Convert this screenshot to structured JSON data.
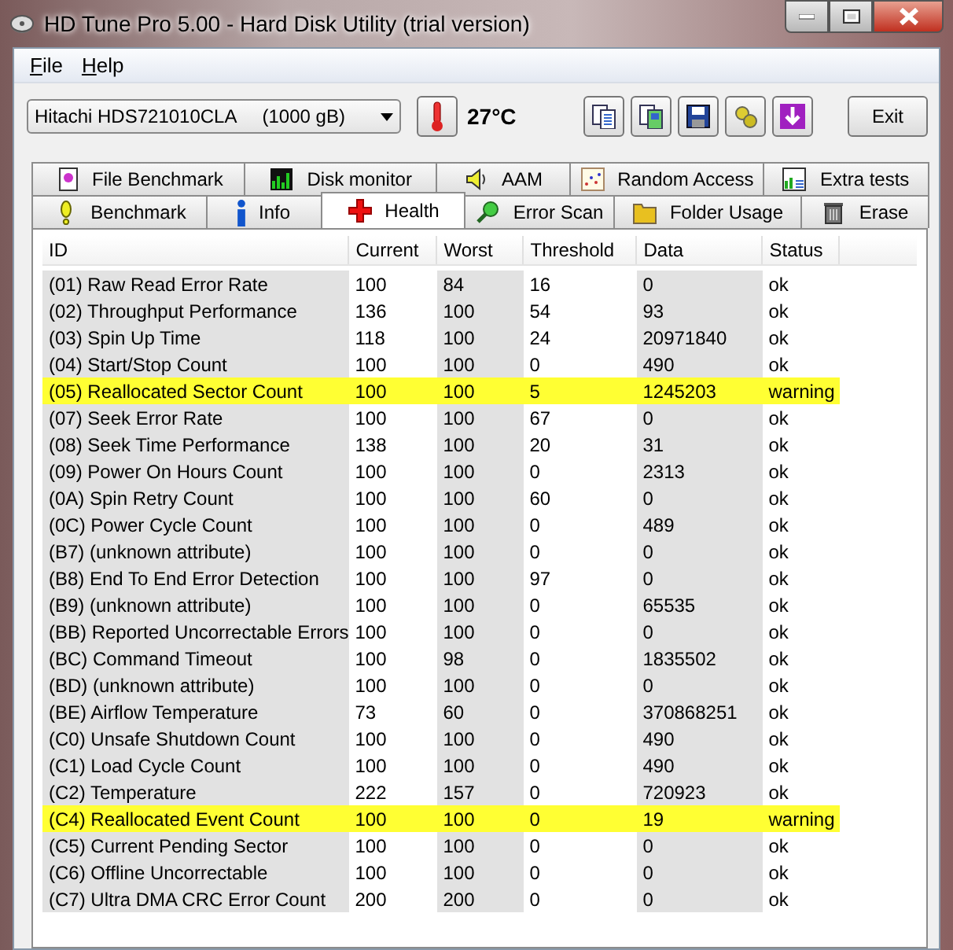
{
  "window": {
    "title": "HD Tune Pro 5.00 - Hard Disk Utility (trial version)"
  },
  "menu": [
    "File",
    "Help"
  ],
  "toolbar": {
    "drive": "Hitachi HDS721010CLA     (1000 gB)",
    "temperature": "27°C",
    "exit": "Exit"
  },
  "tabs": [
    [
      {
        "label": "File Benchmark",
        "selected": false
      },
      {
        "label": "Disk monitor",
        "selected": false
      },
      {
        "label": "AAM",
        "selected": false
      },
      {
        "label": "Random Access",
        "selected": false
      },
      {
        "label": "Extra tests",
        "selected": false
      }
    ],
    [
      {
        "label": "Benchmark",
        "selected": false
      },
      {
        "label": "Info",
        "selected": false
      },
      {
        "label": "Health",
        "selected": true
      },
      {
        "label": "Error Scan",
        "selected": false
      },
      {
        "label": "Folder Usage",
        "selected": false
      },
      {
        "label": "Erase",
        "selected": false
      }
    ]
  ],
  "table": {
    "columns": [
      "ID",
      "Current",
      "Worst",
      "Threshold",
      "Data",
      "Status"
    ],
    "rows": [
      {
        "cells": [
          "(01) Raw Read Error Rate",
          "100",
          "84",
          "16",
          "0",
          "ok"
        ],
        "warning": false
      },
      {
        "cells": [
          "(02) Throughput Performance",
          "136",
          "100",
          "54",
          "93",
          "ok"
        ],
        "warning": false
      },
      {
        "cells": [
          "(03) Spin Up Time",
          "118",
          "100",
          "24",
          "20971840",
          "ok"
        ],
        "warning": false
      },
      {
        "cells": [
          "(04) Start/Stop Count",
          "100",
          "100",
          "0",
          "490",
          "ok"
        ],
        "warning": false
      },
      {
        "cells": [
          "(05) Reallocated Sector Count",
          "100",
          "100",
          "5",
          "1245203",
          "warning"
        ],
        "warning": true
      },
      {
        "cells": [
          "(07) Seek Error Rate",
          "100",
          "100",
          "67",
          "0",
          "ok"
        ],
        "warning": false
      },
      {
        "cells": [
          "(08) Seek Time Performance",
          "138",
          "100",
          "20",
          "31",
          "ok"
        ],
        "warning": false
      },
      {
        "cells": [
          "(09) Power On Hours Count",
          "100",
          "100",
          "0",
          "2313",
          "ok"
        ],
        "warning": false
      },
      {
        "cells": [
          "(0A) Spin Retry Count",
          "100",
          "100",
          "60",
          "0",
          "ok"
        ],
        "warning": false
      },
      {
        "cells": [
          "(0C) Power Cycle Count",
          "100",
          "100",
          "0",
          "489",
          "ok"
        ],
        "warning": false
      },
      {
        "cells": [
          "(B7) (unknown attribute)",
          "100",
          "100",
          "0",
          "0",
          "ok"
        ],
        "warning": false
      },
      {
        "cells": [
          "(B8) End To End Error Detection",
          "100",
          "100",
          "97",
          "0",
          "ok"
        ],
        "warning": false
      },
      {
        "cells": [
          "(B9) (unknown attribute)",
          "100",
          "100",
          "0",
          "65535",
          "ok"
        ],
        "warning": false
      },
      {
        "cells": [
          "(BB) Reported Uncorrectable Errors",
          "100",
          "100",
          "0",
          "0",
          "ok"
        ],
        "warning": false
      },
      {
        "cells": [
          "(BC) Command Timeout",
          "100",
          "98",
          "0",
          "1835502",
          "ok"
        ],
        "warning": false
      },
      {
        "cells": [
          "(BD) (unknown attribute)",
          "100",
          "100",
          "0",
          "0",
          "ok"
        ],
        "warning": false
      },
      {
        "cells": [
          "(BE) Airflow Temperature",
          "73",
          "60",
          "0",
          "370868251",
          "ok"
        ],
        "warning": false
      },
      {
        "cells": [
          "(C0) Unsafe Shutdown Count",
          "100",
          "100",
          "0",
          "490",
          "ok"
        ],
        "warning": false
      },
      {
        "cells": [
          "(C1) Load Cycle Count",
          "100",
          "100",
          "0",
          "490",
          "ok"
        ],
        "warning": false
      },
      {
        "cells": [
          "(C2) Temperature",
          "222",
          "157",
          "0",
          "720923",
          "ok"
        ],
        "warning": false
      },
      {
        "cells": [
          "(C4) Reallocated Event Count",
          "100",
          "100",
          "0",
          "19",
          "warning"
        ],
        "warning": true
      },
      {
        "cells": [
          "(C5) Current Pending Sector",
          "100",
          "100",
          "0",
          "0",
          "ok"
        ],
        "warning": false
      },
      {
        "cells": [
          "(C6) Offline Uncorrectable",
          "100",
          "100",
          "0",
          "0",
          "ok"
        ],
        "warning": false
      },
      {
        "cells": [
          "(C7) Ultra DMA CRC Error Count",
          "200",
          "200",
          "0",
          "0",
          "ok"
        ],
        "warning": false
      }
    ]
  }
}
